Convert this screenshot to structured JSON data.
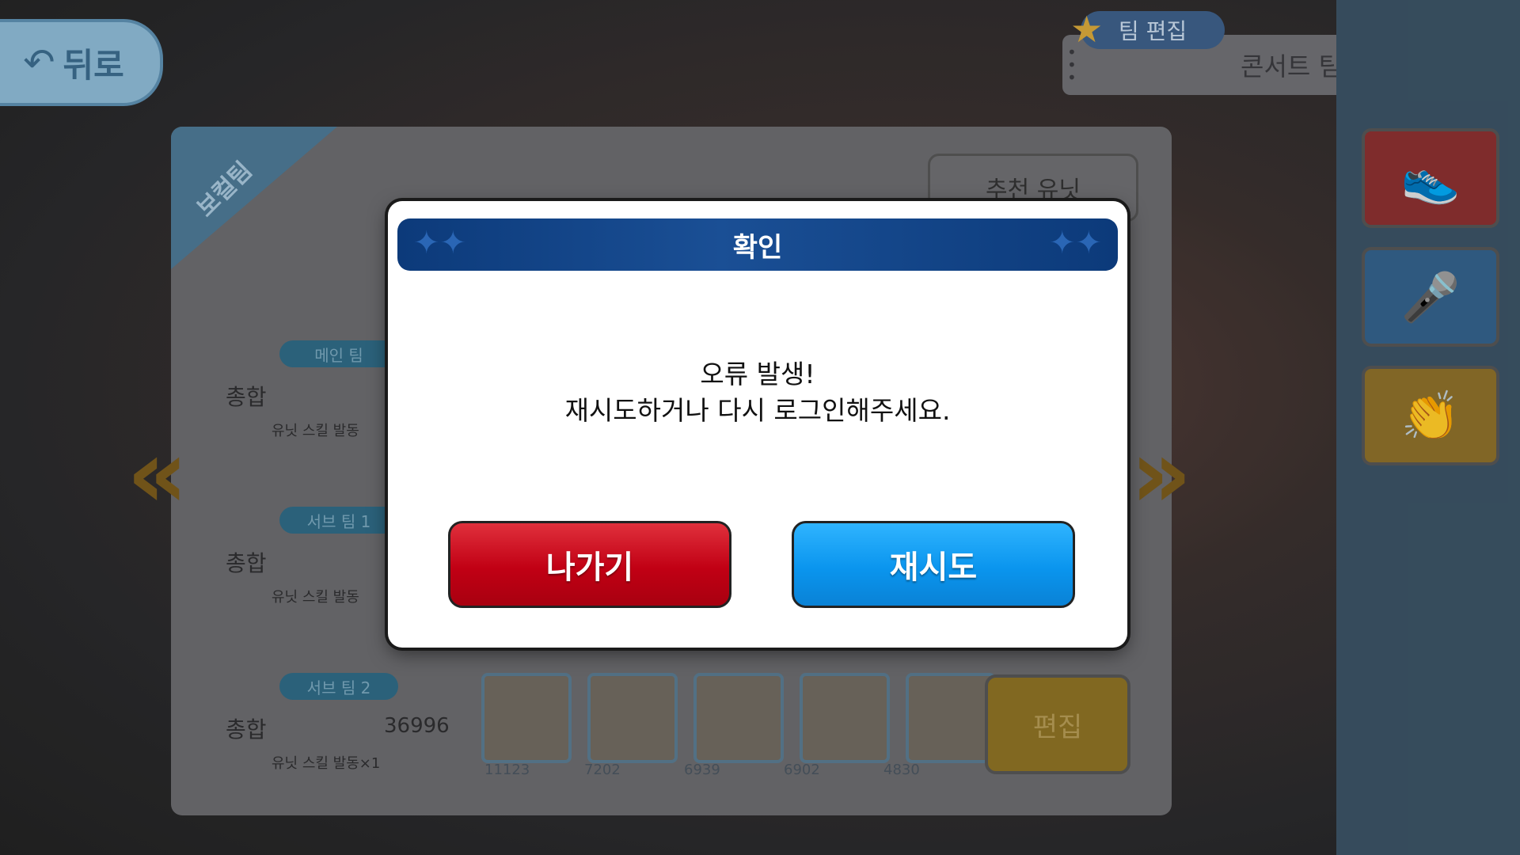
{
  "background": {
    "back_button": {
      "icon": "undo-arrow-icon",
      "label": "뒤로"
    },
    "team_edit_tag": "팀 편집",
    "team_name": "콘서트 팀",
    "ribbon_label": "보컬팀",
    "recommend_button": "추천 유닛",
    "teams": [
      {
        "pill": "메인 팀",
        "total_label": "총합",
        "total_value": "",
        "sub": "유닛 스킬 발동"
      },
      {
        "pill": "서브 팀 1",
        "total_label": "총합",
        "total_value": "",
        "sub": "유닛 스킬 발동"
      },
      {
        "pill": "서브 팀 2",
        "total_label": "총합",
        "total_value": "36996",
        "sub": "유닛 스킬 발동×1"
      }
    ],
    "card_values": [
      "11123",
      "7202",
      "6939",
      "6902",
      "4830"
    ],
    "edit_button": "편집"
  },
  "dialog": {
    "title": "확인",
    "message_line1": "오류 발생!",
    "message_line2": "재시도하거나 다시 로그인해주세요.",
    "exit_label": "나가기",
    "retry_label": "재시도"
  }
}
